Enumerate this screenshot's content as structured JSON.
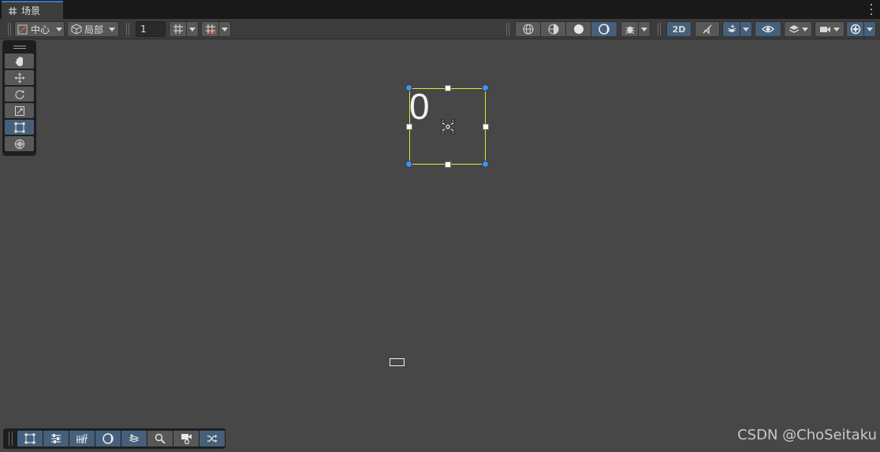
{
  "tab": {
    "icon": "grid-icon",
    "label": "场景"
  },
  "toolbar": {
    "pivot_label": "中心",
    "space_label": "局部",
    "grid_size_value": "1",
    "mode_2d_label": "2D",
    "icons": [
      "pivot-icon",
      "local-cube-icon",
      "grid-snap-icon",
      "increment-snap-icon",
      "wireframe-icon",
      "shaded-wireframe-icon",
      "shaded-icon",
      "lighting-icon",
      "debug-icon",
      "audio-mute-icon",
      "effects-icon",
      "visibility-icon",
      "layers-icon",
      "camera-icon",
      "gizmos-icon"
    ]
  },
  "tools": {
    "items": [
      "hand-tool-icon",
      "move-tool-icon",
      "rotate-tool-icon",
      "scale-tool-icon",
      "rect-tool-icon",
      "transform-tool-icon"
    ],
    "active": "rect-tool-icon"
  },
  "scene": {
    "text_value": "0"
  },
  "bottom_toolbar": {
    "items": [
      "rect-overlay-icon",
      "sliders-icon",
      "tilemap-icon",
      "shading-overlay-icon",
      "layers-overlay-icon",
      "search-overlay-icon",
      "camera-overlay-icon",
      "shuffle-icon"
    ]
  },
  "watermark": "CSDN @ChoSeitaku",
  "colors": {
    "accent": "#46607c",
    "selection": "#e8e23c",
    "handle": "#4a8fe0",
    "background": "#474747"
  }
}
